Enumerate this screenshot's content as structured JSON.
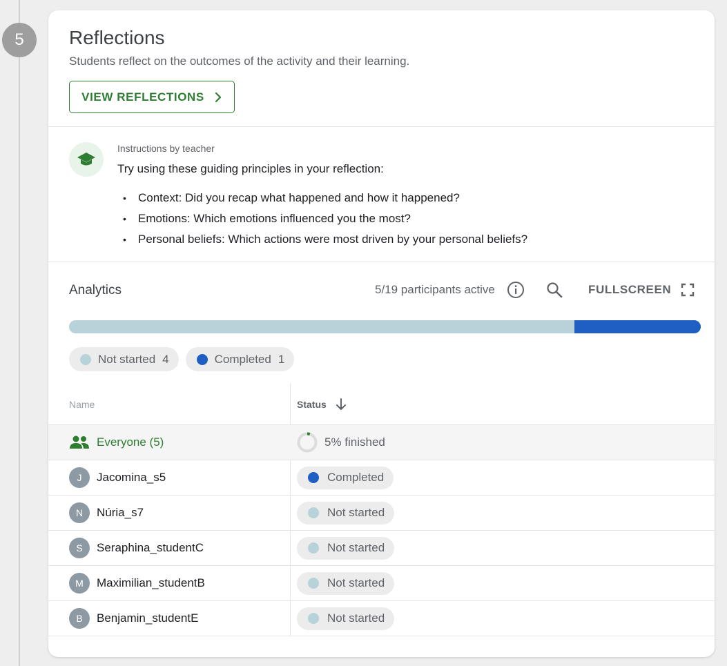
{
  "step": {
    "number": "5"
  },
  "header": {
    "title": "Reflections",
    "subtitle": "Students reflect on the outcomes of the activity and their learning.",
    "view_button_label": "VIEW REFLECTIONS"
  },
  "instructions": {
    "label": "Instructions by teacher",
    "lead": "Try using these guiding principles in your reflection:",
    "items": [
      "Context: Did you recap what happened and how it happened?",
      "Emotions: Which emotions influenced you the most?",
      "Personal beliefs: Which actions were most driven by your personal beliefs?"
    ]
  },
  "analytics": {
    "title": "Analytics",
    "participants_text": "5/19 participants active",
    "fullscreen_label": "FULLSCREEN",
    "progress_completed_fraction": 0.2,
    "legend": [
      {
        "label": "Not started",
        "count": "4",
        "color": "#b8d2da"
      },
      {
        "label": "Completed",
        "count": "1",
        "color": "#1f5fc4"
      }
    ]
  },
  "table": {
    "col_name": "Name",
    "col_status": "Status",
    "everyone": {
      "label": "Everyone (5)",
      "finished": "5% finished",
      "finished_fraction": 0.05
    },
    "rows": [
      {
        "initial": "J",
        "name": "Jacomina_s5",
        "status": "Completed",
        "color": "#1f5fc4"
      },
      {
        "initial": "N",
        "name": "Núria_s7",
        "status": "Not started",
        "color": "#b8d2da"
      },
      {
        "initial": "S",
        "name": "Seraphina_studentC",
        "status": "Not started",
        "color": "#b8d2da"
      },
      {
        "initial": "M",
        "name": "Maximilian_studentB",
        "status": "Not started",
        "color": "#b8d2da"
      },
      {
        "initial": "B",
        "name": "Benjamin_studentE",
        "status": "Not started",
        "color": "#b8d2da"
      }
    ]
  },
  "colors": {
    "brand_green": "#2e7d32",
    "completed_blue": "#1f5fc4",
    "not_started": "#b8d2da"
  }
}
